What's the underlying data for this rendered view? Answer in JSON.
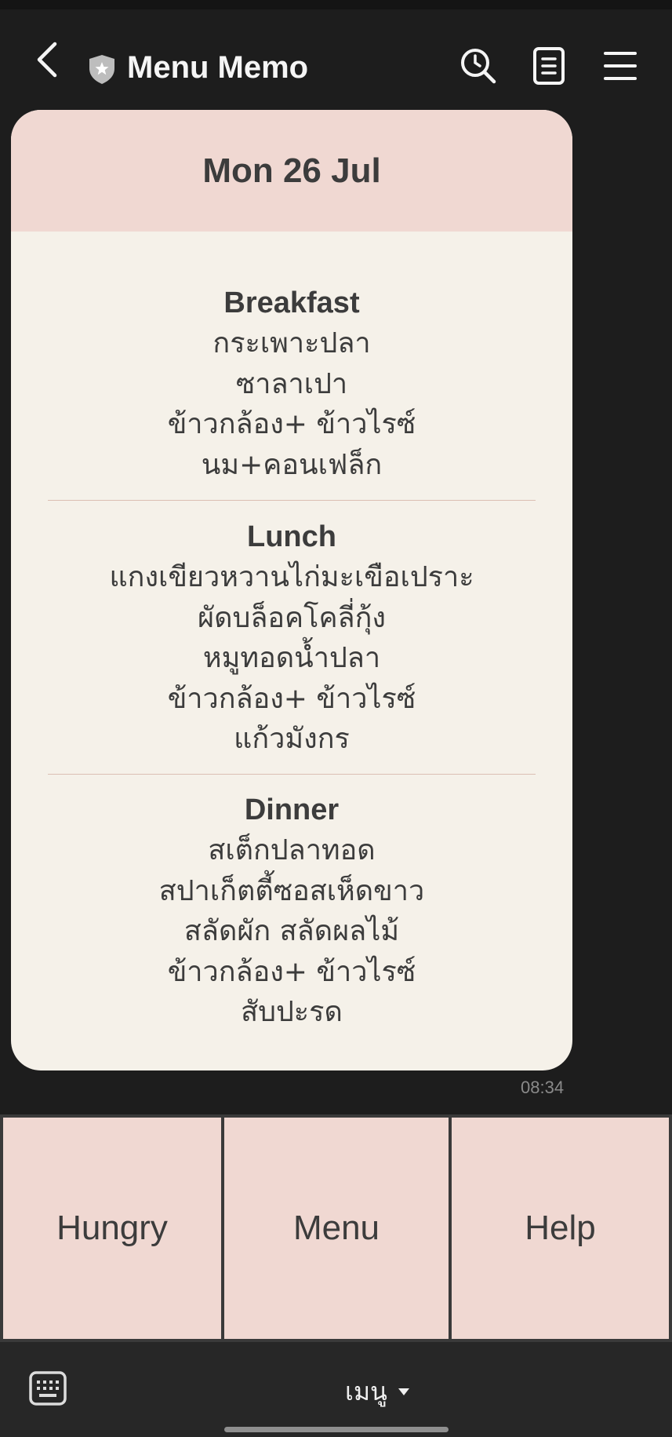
{
  "header": {
    "title": "Menu Memo",
    "icons": [
      "chevron-left-icon",
      "shield-star-icon",
      "search-icon",
      "notes-icon",
      "hamburger-menu-icon"
    ]
  },
  "message": {
    "date": "Mon 26 Jul",
    "breakfast": {
      "title": "Breakfast",
      "items": [
        "กระเพาะปลา",
        "ซาลาเปา",
        "ข้าวกล้อง+ ข้าวไรซ์",
        "นม+คอนเฟล็ก"
      ]
    },
    "lunch": {
      "title": "Lunch",
      "items": [
        "แกงเขียวหวานไก่มะเขือเปราะ",
        "ผัดบล็อคโคลี่กุ้ง",
        "หมูทอดน้ำปลา",
        "ข้าวกล้อง+ ข้าวไรซ์",
        "แก้วมังกร"
      ]
    },
    "dinner": {
      "title": "Dinner",
      "items": [
        "สเต็กปลาทอด",
        "สปาเก็ตตี้ซอสเห็ดขาว",
        "สลัดผัก สลัดผลไม้",
        "ข้าวกล้อง+ ข้าวไรซ์",
        "สับปะรด"
      ]
    },
    "time": "08:34"
  },
  "rich_menu": {
    "buttons": [
      "Hungry",
      "Menu",
      "Help"
    ]
  },
  "bottom_bar": {
    "menu_label": "เมนู"
  },
  "colors": {
    "background": "#1d1d1d",
    "card_header": "#f0d8d2",
    "card_body": "#f5f1e9",
    "text_dark": "#3c3c3c"
  }
}
